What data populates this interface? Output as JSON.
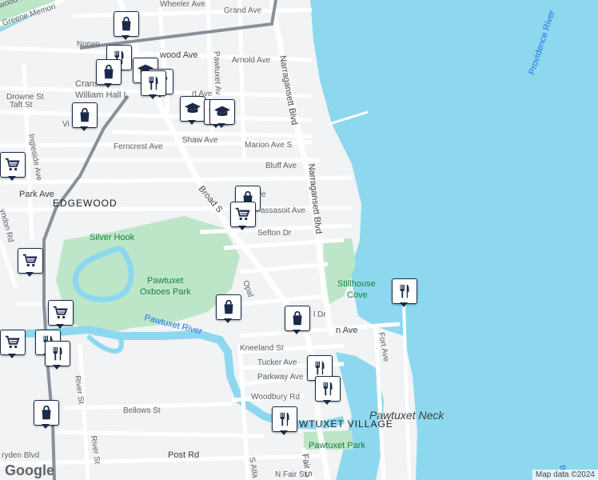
{
  "map": {
    "streets": {
      "wheeler": "Wheeler Ave",
      "grand": "Grand Ave",
      "greene_memorial": "Greene Memori",
      "norwood_w": "Norwo",
      "norwood_e": "wood Ave",
      "arnold": "Arnold Ave",
      "pawtuxet_ave": "Pawtuxet Av",
      "narragansett_n": "Narragansett Blvd",
      "narragansett_s": "Narragansett Blvd",
      "drowne": "Drowne St",
      "taft": "Taft St",
      "via": "Vi",
      "ferncrest": "Ferncrest Ave",
      "shaw": "Shaw Ave",
      "marion": "Marion Ave S",
      "bluff": "Bluff Ave",
      "ingleside": "Ingleside Ave",
      "park": "Park Ave",
      "broad": "Broad S",
      "massasoit": "assasoit Ave",
      "sefton": "Sefton Dr",
      "lyndon": "yndon Rd",
      "opal": "Opal",
      "kneeland": "Kneeland St",
      "tucker": "Tucker Ave",
      "parkway": "Parkway Ave",
      "woodbury": "Woodbury Rd",
      "fort": "Fort Ave",
      "bellows": "Bellows St",
      "river_st_1": "River St",
      "river_st_2": "River St",
      "dryden": "ryden Blvd",
      "post": "Post Rd",
      "atlantic": "S Atla",
      "fair": "Fair S",
      "n_fair": "N Fair St",
      "bay": "Bay",
      "ave_tail": "ve",
      "ave_tail2": "rt Ave",
      "n_ave": "n Ave",
      "l_dr": "l Dr",
      "wood_lake": "wood La"
    },
    "places": {
      "edgewood": "EDGEWOOD",
      "silver_hook": "Silver Hook",
      "pawtuxet_oxboes_1": "Pawtuxet",
      "pawtuxet_oxboes_2": "Oxboes Park",
      "pawtuxet_river": "Pawtuxet River",
      "stillhouse_1": "Stillhouse",
      "stillhouse_2": "Cove",
      "pawtuxet_neck": "Pawtuxet Neck",
      "pawtuxet_village": "WTUXET VILLAGE",
      "pawtuxet_park": "Pawtuxet Park",
      "providence_river": "Providence River",
      "cranston_1": "Cranston",
      "cranston_2": "William Hall L"
    },
    "colors": {
      "water": "#8ed8ef",
      "land": "#f1f3f4",
      "park": "#bde6c9",
      "road": "#ffffff",
      "highway": "#8a9099",
      "pin_border": "#1a2b4a"
    },
    "pins": [
      {
        "icon": "shopping-bag-icon"
      },
      {
        "icon": "restaurant-icon"
      },
      {
        "icon": "school-icon"
      },
      {
        "icon": "shopping-bag-icon"
      },
      {
        "icon": "grocery-cart-icon"
      },
      {
        "icon": "restaurant-icon"
      },
      {
        "icon": "school-icon"
      },
      {
        "icon": "school-icon"
      },
      {
        "icon": "shopping-bag-icon"
      },
      {
        "icon": "school-icon"
      },
      {
        "icon": "grocery-cart-icon"
      },
      {
        "icon": "shopping-bag-icon"
      },
      {
        "icon": "grocery-cart-icon"
      },
      {
        "icon": "grocery-cart-icon"
      },
      {
        "icon": "grocery-cart-icon"
      },
      {
        "icon": "restaurant-icon"
      },
      {
        "icon": "restaurant-icon"
      },
      {
        "icon": "shopping-bag-icon"
      },
      {
        "icon": "restaurant-icon"
      },
      {
        "icon": "shopping-bag-icon"
      },
      {
        "icon": "grocery-cart-icon"
      },
      {
        "icon": "restaurant-icon"
      },
      {
        "icon": "restaurant-icon"
      },
      {
        "icon": "shopping-bag-icon"
      },
      {
        "icon": "restaurant-icon"
      }
    ],
    "logo": "Google",
    "credit": "Map data ©2024"
  }
}
